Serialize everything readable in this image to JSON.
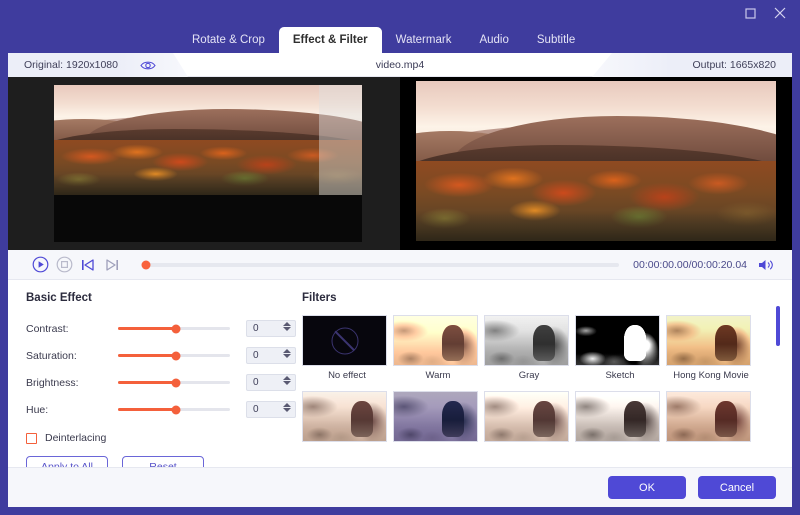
{
  "window": {
    "controls": [
      {
        "name": "maximize",
        "glyph": "maximize-icon"
      },
      {
        "name": "close",
        "glyph": "close-icon"
      }
    ]
  },
  "tabs": [
    {
      "label": "Rotate & Crop",
      "active": false
    },
    {
      "label": "Effect & Filter",
      "active": true
    },
    {
      "label": "Watermark",
      "active": false
    },
    {
      "label": "Audio",
      "active": false
    },
    {
      "label": "Subtitle",
      "active": false
    }
  ],
  "info": {
    "original_label": "Original: 1920x1080",
    "eye_icon": "eye-icon",
    "file_name": "video.mp4",
    "output_label": "Output: 1665x820"
  },
  "player": {
    "play_icon": "play-circle-icon",
    "stop_icon": "stop-circle-icon",
    "prev_icon": "previous-frame-icon",
    "next_icon": "next-frame-icon",
    "timecode": "00:00:00.00/00:00:20.04",
    "volume_icon": "volume-icon",
    "playhead_percent": 0
  },
  "basic_effect": {
    "title": "Basic Effect",
    "sliders": [
      {
        "label": "Contrast:",
        "value": "0",
        "percent": 52
      },
      {
        "label": "Saturation:",
        "value": "0",
        "percent": 52
      },
      {
        "label": "Brightness:",
        "value": "0",
        "percent": 52
      },
      {
        "label": "Hue:",
        "value": "0",
        "percent": 52
      }
    ],
    "checkbox": {
      "label": "Deinterlacing",
      "checked": false
    },
    "apply_all_label": "Apply to All",
    "reset_label": "Reset"
  },
  "filters": {
    "title": "Filters",
    "items": [
      {
        "label": "No effect",
        "style": "f-none",
        "selected": false
      },
      {
        "label": "Warm",
        "style": "f-warm",
        "selected": false
      },
      {
        "label": "Gray",
        "style": "f-gray",
        "selected": false
      },
      {
        "label": "Sketch",
        "style": "f-sketch",
        "selected": false
      },
      {
        "label": "Hong Kong Movie",
        "style": "f-hk",
        "selected": false
      },
      {
        "label": "",
        "style": "f-r2a",
        "selected": false
      },
      {
        "label": "",
        "style": "f-r2b",
        "selected": false
      },
      {
        "label": "",
        "style": "f-r2c",
        "selected": false
      },
      {
        "label": "",
        "style": "f-r2d",
        "selected": false
      },
      {
        "label": "",
        "style": "f-r2e",
        "selected": false
      }
    ],
    "scroll_thumb_percent": 0
  },
  "footer": {
    "ok_label": "OK",
    "cancel_label": "Cancel"
  },
  "colors": {
    "brand": "#4f49d6",
    "titlebar": "#3f3c9e",
    "accent_slider": "#f4603b",
    "panel": "#f6f7fb"
  }
}
